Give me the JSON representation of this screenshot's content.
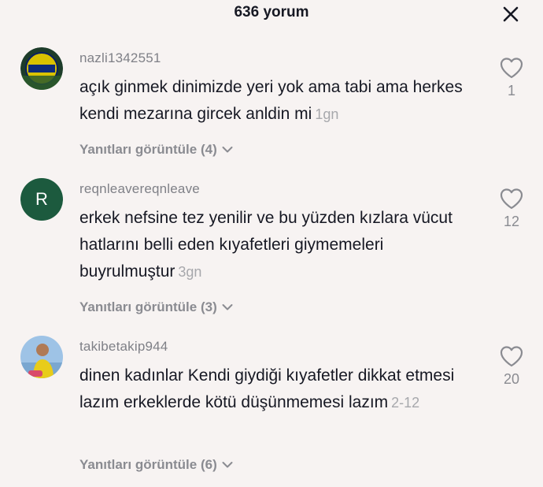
{
  "header": {
    "title": "636 yorum",
    "close_icon": "close-icon"
  },
  "comments": [
    {
      "username": "nazli1342551",
      "avatar": "club-logo",
      "text": "açık ginmek dinimizde yeri yok ama tabi ama herkes kendi mezarına gircek anldin mi",
      "time": "1gn",
      "replies_label": "Yanıtları görüntüle (4)",
      "likes": "1"
    },
    {
      "username": "reqnleavereqnleave",
      "avatar_letter": "R",
      "text": "erkek nefsine tez yenilir ve bu yüzden kızlara vücut hatlarını belli eden kıyafetleri giymemeleri buyrulmuştur",
      "time": "3gn",
      "replies_label": "Yanıtları görüntüle (3)",
      "likes": "12"
    },
    {
      "username": "takibetakip944",
      "avatar": "user-photo",
      "text": "dinen kadınlar Kendi giydiği kıyafetler dikkat etmesi lazım erkeklerde kötü düşünmemesi lazım",
      "time": "2-12",
      "replies_label": "Yanıtları görüntüle (6)",
      "likes": "20"
    }
  ],
  "colors": {
    "background": "#f7f3f2",
    "text": "#161823",
    "muted": "#8a8b91",
    "avatar_green": "#1c5a3e"
  }
}
